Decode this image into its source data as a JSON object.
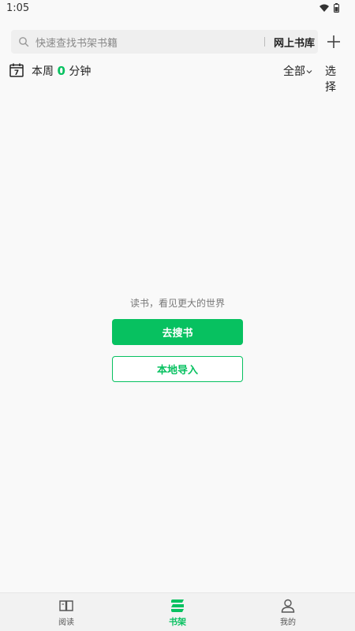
{
  "status_bar": {
    "time": "1:05"
  },
  "search": {
    "placeholder": "快速查找书架书籍",
    "online_library_label": "网上书库"
  },
  "week_stats": {
    "prefix": "本周",
    "minutes": "0",
    "suffix": "分钟",
    "calendar_day": "7"
  },
  "toolbar": {
    "filter_label": "全部",
    "select_label": "选择"
  },
  "empty_state": {
    "message": "读书，看见更大的世界",
    "go_search_label": "去搜书",
    "local_import_label": "本地导入"
  },
  "bottom_nav": {
    "items": [
      {
        "label": "阅读",
        "icon": "open-book-icon"
      },
      {
        "label": "书架",
        "icon": "bookshelf-icon"
      },
      {
        "label": "我的",
        "icon": "person-icon"
      }
    ],
    "active_index": 1
  },
  "colors": {
    "accent": "#07c160"
  }
}
